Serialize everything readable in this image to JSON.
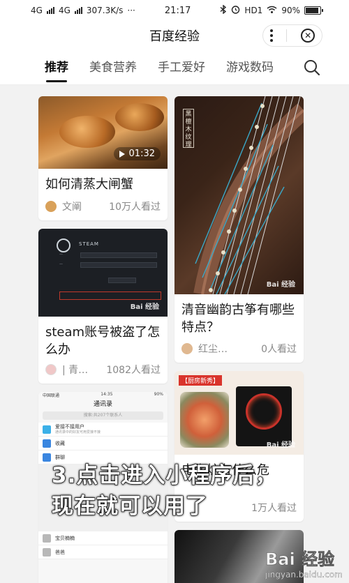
{
  "status_bar": {
    "network1": "4G",
    "network2": "4G",
    "speed": "307.3K/s",
    "dots": "···",
    "time": "21:17",
    "hd": "HD1",
    "battery": "90%",
    "battery_level": 0.9
  },
  "header": {
    "title": "百度经验",
    "more_icon": "more-dots-icon",
    "close_icon": "close-circle-icon"
  },
  "tabs": [
    {
      "label": "推荐",
      "active": true
    },
    {
      "label": "美食营养",
      "active": false
    },
    {
      "label": "手工爱好",
      "active": false
    },
    {
      "label": "游戏数码",
      "active": false
    }
  ],
  "feed": {
    "cards": [
      {
        "title": "如何清蒸大闸蟹",
        "author": "文阐",
        "views": "10万人看过",
        "duration": "01:32"
      },
      {
        "title": "清音幽韵古筝有哪些特点？",
        "author": "红尘…",
        "views": "0人看过",
        "label": "黑檀木纹理"
      },
      {
        "title": "steam账号被盗了怎么办",
        "author": "| 青…",
        "views": "1082人看过",
        "logo": "STEAM"
      },
      {
        "title": "电陶炉有什么危",
        "author": "",
        "views": "1万人看过",
        "banner": "【厨房新秀】"
      },
      {
        "screenshot_title": "通讯录",
        "status_left": "中国联通",
        "status_time": "14:35",
        "status_right": "90%",
        "search": "搜索:共207个联系人",
        "rows": [
          {
            "label": "爱接不接用户",
            "sub": "通讯录中的好友可用爱接不接"
          },
          {
            "label": "收藏"
          },
          {
            "label": "群聊"
          },
          {
            "label": "宝贝楠楠"
          },
          {
            "label": "爸爸"
          }
        ]
      }
    ]
  },
  "overlay": {
    "line1": "3.点击进入小程序后，",
    "line2": "现在就可以用了"
  },
  "watermark": {
    "main": "Bai 经验",
    "sub": "jingyan.baidu.com",
    "small": "Bai 经验"
  },
  "colors": {
    "accent": "#111111",
    "background": "#f2f2f2",
    "overlay_text": "#ffffff"
  }
}
